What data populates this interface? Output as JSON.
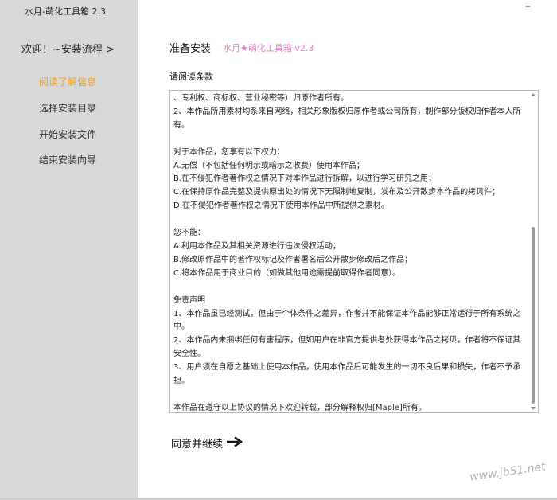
{
  "window": {
    "title": "水月-萌化工具箱 2.3",
    "minimize_label": "–"
  },
  "sidebar": {
    "heading": "欢迎！~安装流程 >",
    "steps": [
      {
        "label": "阅读了解信息",
        "active": true
      },
      {
        "label": "选择安装目录",
        "active": false
      },
      {
        "label": "开始安装文件",
        "active": false
      },
      {
        "label": "结束安装向导",
        "active": false
      }
    ]
  },
  "main": {
    "title": "准备安装",
    "subtitle": "水月★萌化工具箱 v2.3",
    "license_label": "请阅读条款",
    "license_lines": [
      "、专利权、商标权、营业秘密等）归原作者所有。",
      "2、本作品所用素材均系来自网络，相关形象版权归原作者或公司所有，制作部分版权归作者本人所有。",
      "",
      "对于本作品，您享有以下权力：",
      "A.无偿（不包括任何明示或暗示之收费）使用本作品；",
      "B.在不侵犯作者著作权之情况下对本作品进行拆解，以进行学习研究之用；",
      "C.在保持原作品完整及提供原出处的情况下无限制地复制，发布及公开散步本作品的拷贝件；",
      "D.在不侵犯作者著作权之情况下使用本作品中所提供之素材。",
      "",
      "您不能：",
      "A.利用本作品及其相关资源进行违法侵权活动；",
      "B.修改原作品中的著作权标记及作者署名后公开散步修改后之作品；",
      "C.将本作品用于商业目的（如做其他用途需提前取得作者同意）。",
      "",
      "免责声明",
      "1、本作品虽已经测试，但由于个体条件之差异，作者并不能保证本作品能够正常运行于所有系统之中。",
      "2、本作品内未捆绑任何有害程序，但如用户在非官方提供者处获得本作品之拷贝，作者将不保证其安全性。",
      "3、用户须在自愿之基础上使用本作品，使用本作品后可能发生的一切不良后果和损失，作者不予承担。",
      "",
      "本作品在遵守以上协议的情况下欢迎转载，部分解释权归[Maple]所有。"
    ],
    "continue_label": "同意并继续"
  },
  "watermark": "www.jb51.net",
  "colors": {
    "sidebar_bg": "#d9d9d9",
    "active_step": "#f0a020",
    "subtitle": "#e880c8"
  },
  "icons": {
    "continue_arrow": "arrow-right-icon"
  }
}
